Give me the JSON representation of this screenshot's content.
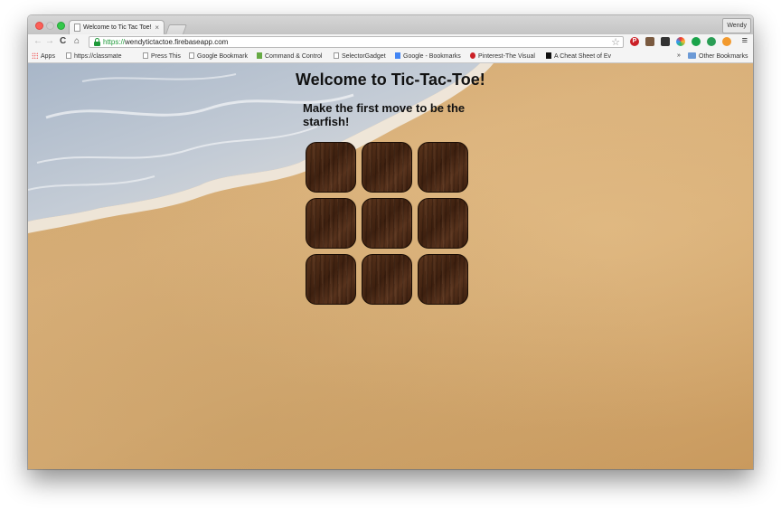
{
  "browser": {
    "profile_name": "Wendy",
    "tab": {
      "title": "Welcome to Tic Tac Toe!",
      "close": "×"
    },
    "omnibox": {
      "scheme": "https://",
      "host": "wendytictactoe.firebaseapp.com"
    },
    "nav": {
      "back": "←",
      "forward": "→",
      "reload": "C",
      "home": "⌂",
      "star": "☆",
      "menu": "≡"
    },
    "bookmarks": [
      {
        "label": "Apps",
        "icon": "apps-icon"
      },
      {
        "label": "https://classmate",
        "icon": "page-icon"
      },
      {
        "label": "Press This",
        "icon": "page-icon"
      },
      {
        "label": "Google Bookmark",
        "icon": "page-icon"
      },
      {
        "label": "Command & Control",
        "icon": "page-icon"
      },
      {
        "label": "SelectorGadget",
        "icon": "page-icon"
      },
      {
        "label": "Google - Bookmarks",
        "icon": "google-icon"
      },
      {
        "label": "Pinterest-The Visual",
        "icon": "pinterest-icon"
      },
      {
        "label": "A Cheat Sheet of Ev",
        "icon": "g-icon"
      }
    ],
    "overflow": "»",
    "other_bookmarks": "Other Bookmarks",
    "accent_green": "#1f9a3a"
  },
  "page": {
    "title": "Welcome to Tic-Tac-Toe!",
    "subtitle": "Make the first move to be the starfish!",
    "board_cells": 9
  }
}
